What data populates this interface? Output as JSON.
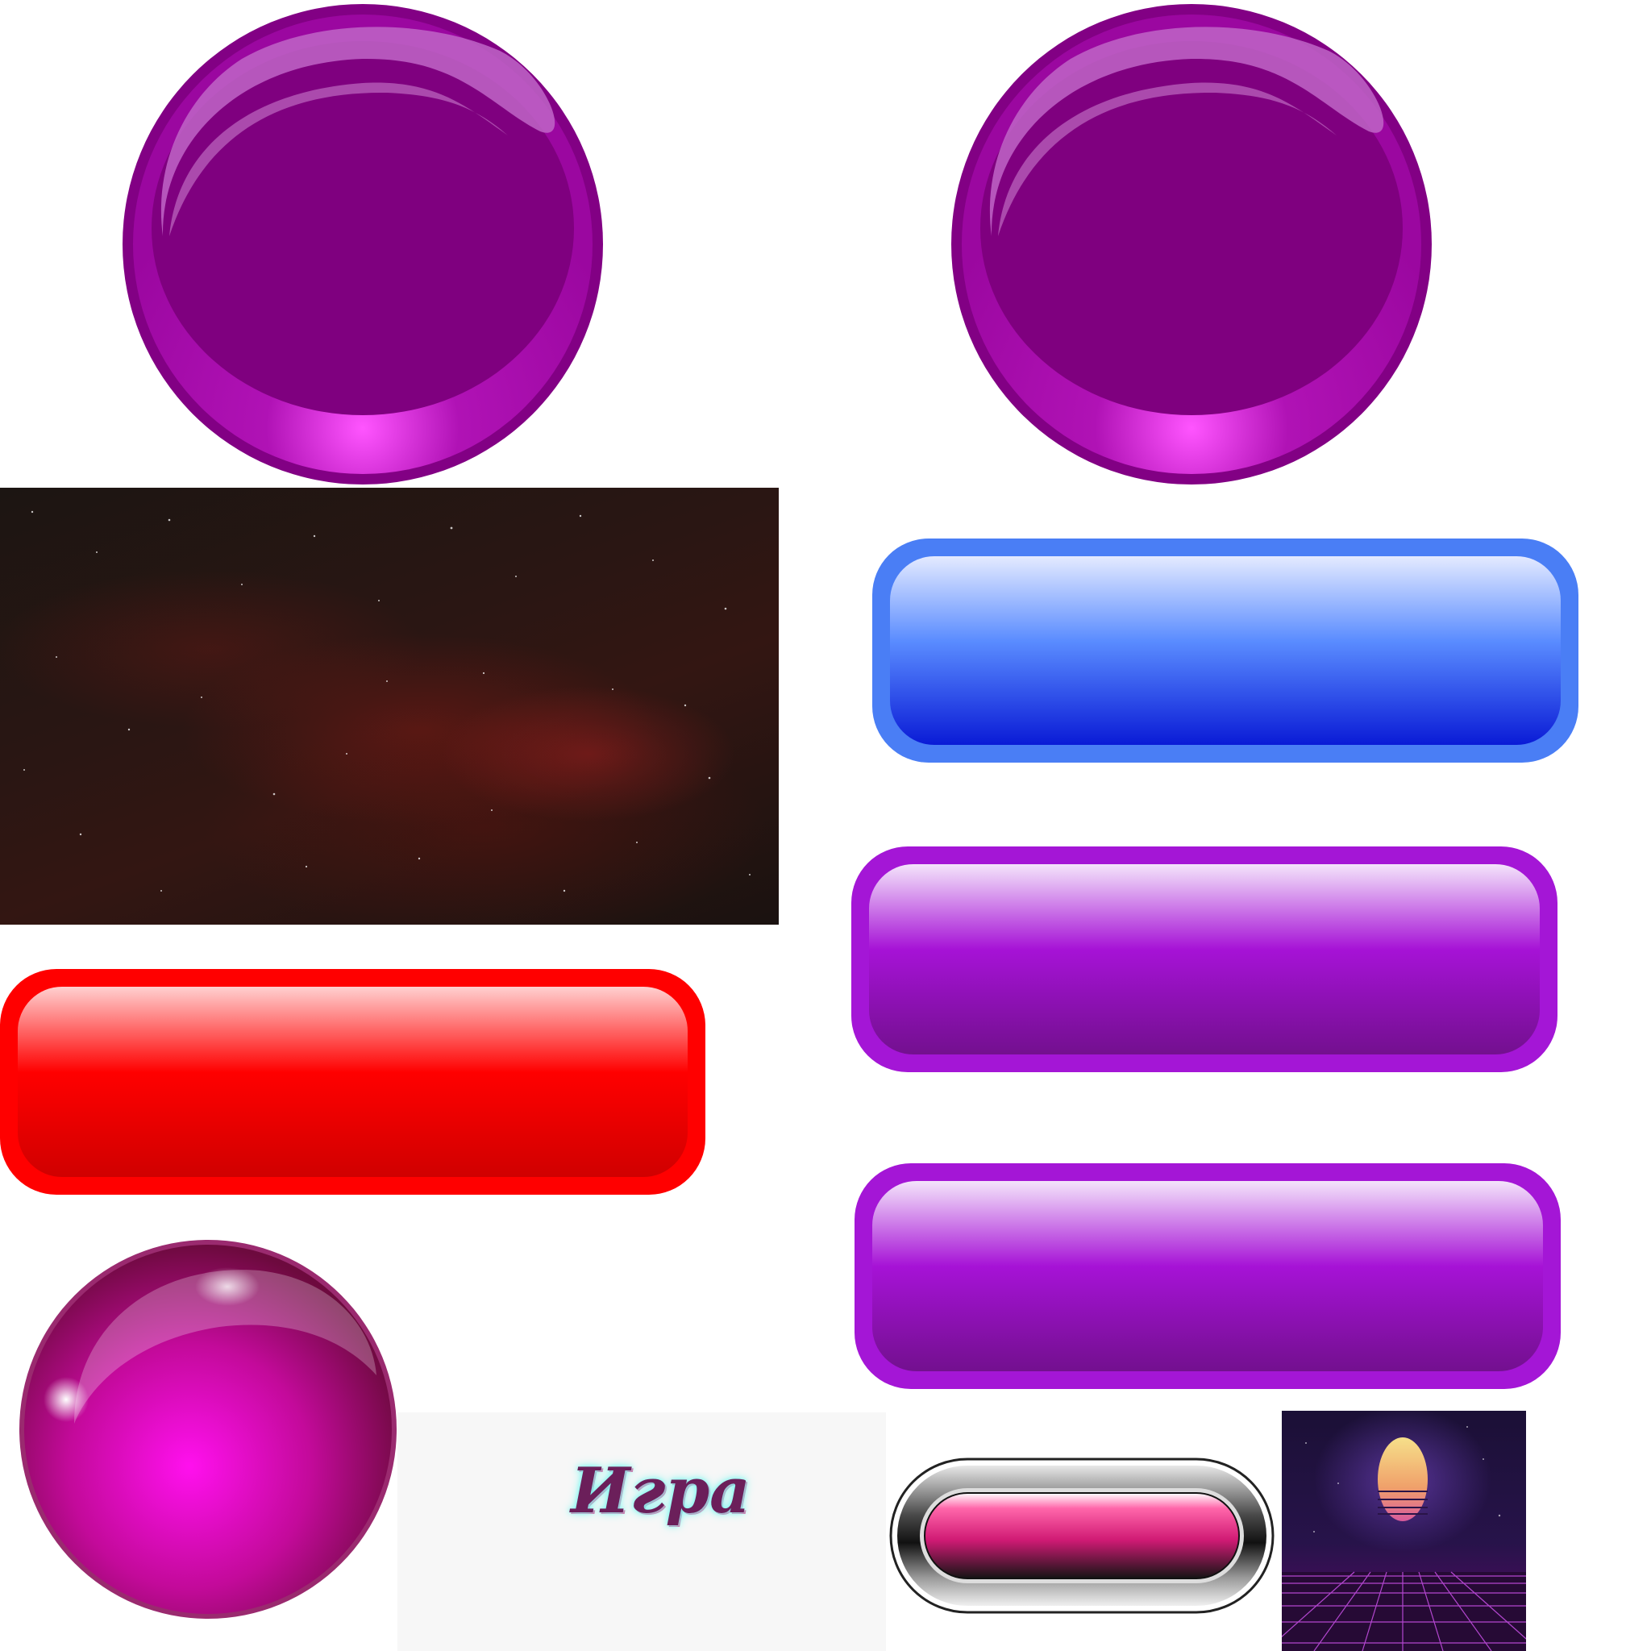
{
  "sprites": {
    "round_buttons": [
      "purple-round-button",
      "purple-round-button"
    ],
    "rect_buttons": {
      "blue": {
        "fill_top": "#e4eaff",
        "fill_mid": "#4f87ff",
        "fill_bottom": "#0a1bd6",
        "border": "#4a7ef5"
      },
      "purple": {
        "fill_top": "#f4e4fb",
        "fill_mid": "#a612d6",
        "fill_bottom": "#73108f",
        "border": "#a416d6"
      },
      "red": {
        "fill_top": "#ffd0d0",
        "fill_mid": "#ff0000",
        "fill_bottom": "#d00000",
        "border": "#ff0000"
      }
    },
    "round_button_colors": {
      "base": "#7f007f",
      "rim": "#9b07a0",
      "glow": "#ff55ff"
    },
    "orb_color": "#ff10ee"
  },
  "logo": {
    "text": "Игра"
  }
}
